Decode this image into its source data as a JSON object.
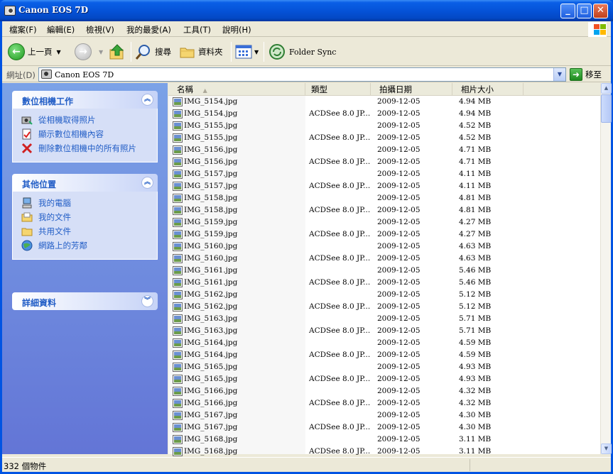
{
  "window": {
    "title": "Canon EOS 7D"
  },
  "menu": [
    "檔案(F)",
    "編輯(E)",
    "檢視(V)",
    "我的最愛(A)",
    "工具(T)",
    "說明(H)"
  ],
  "toolbar": {
    "back": "上一頁",
    "search": "搜尋",
    "folders": "資料夾",
    "folder_sync": "Folder Sync"
  },
  "address": {
    "label": "網址(D)",
    "value": "Canon EOS 7D",
    "go": "移至"
  },
  "taskpane": {
    "camera_tasks": {
      "title": "數位相機工作",
      "links": [
        "從相機取得照片",
        "顯示數位相機內容",
        "刪除數位相機中的所有照片"
      ]
    },
    "other_places": {
      "title": "其他位置",
      "links": [
        "我的電腦",
        "我的文件",
        "共用文件",
        "網路上的芳鄰"
      ]
    },
    "details": {
      "title": "詳細資料"
    }
  },
  "columns": {
    "name": "名稱",
    "type": "類型",
    "date": "拍攝日期",
    "size": "相片大小"
  },
  "files": [
    {
      "name": "IMG_5154.jpg",
      "type": "",
      "date": "2009-12-05",
      "size": "4.94 MB"
    },
    {
      "name": "IMG_5154.jpg",
      "type": "ACDSee 8.0 JP...",
      "date": "2009-12-05",
      "size": "4.94 MB"
    },
    {
      "name": "IMG_5155.jpg",
      "type": "",
      "date": "2009-12-05",
      "size": "4.52 MB"
    },
    {
      "name": "IMG_5155.jpg",
      "type": "ACDSee 8.0 JP...",
      "date": "2009-12-05",
      "size": "4.52 MB"
    },
    {
      "name": "IMG_5156.jpg",
      "type": "",
      "date": "2009-12-05",
      "size": "4.71 MB"
    },
    {
      "name": "IMG_5156.jpg",
      "type": "ACDSee 8.0 JP...",
      "date": "2009-12-05",
      "size": "4.71 MB"
    },
    {
      "name": "IMG_5157.jpg",
      "type": "",
      "date": "2009-12-05",
      "size": "4.11 MB"
    },
    {
      "name": "IMG_5157.jpg",
      "type": "ACDSee 8.0 JP...",
      "date": "2009-12-05",
      "size": "4.11 MB"
    },
    {
      "name": "IMG_5158.jpg",
      "type": "",
      "date": "2009-12-05",
      "size": "4.81 MB"
    },
    {
      "name": "IMG_5158.jpg",
      "type": "ACDSee 8.0 JP...",
      "date": "2009-12-05",
      "size": "4.81 MB"
    },
    {
      "name": "IMG_5159.jpg",
      "type": "",
      "date": "2009-12-05",
      "size": "4.27 MB"
    },
    {
      "name": "IMG_5159.jpg",
      "type": "ACDSee 8.0 JP...",
      "date": "2009-12-05",
      "size": "4.27 MB"
    },
    {
      "name": "IMG_5160.jpg",
      "type": "",
      "date": "2009-12-05",
      "size": "4.63 MB"
    },
    {
      "name": "IMG_5160.jpg",
      "type": "ACDSee 8.0 JP...",
      "date": "2009-12-05",
      "size": "4.63 MB"
    },
    {
      "name": "IMG_5161.jpg",
      "type": "",
      "date": "2009-12-05",
      "size": "5.46 MB"
    },
    {
      "name": "IMG_5161.jpg",
      "type": "ACDSee 8.0 JP...",
      "date": "2009-12-05",
      "size": "5.46 MB"
    },
    {
      "name": "IMG_5162.jpg",
      "type": "",
      "date": "2009-12-05",
      "size": "5.12 MB"
    },
    {
      "name": "IMG_5162.jpg",
      "type": "ACDSee 8.0 JP...",
      "date": "2009-12-05",
      "size": "5.12 MB"
    },
    {
      "name": "IMG_5163.jpg",
      "type": "",
      "date": "2009-12-05",
      "size": "5.71 MB"
    },
    {
      "name": "IMG_5163.jpg",
      "type": "ACDSee 8.0 JP...",
      "date": "2009-12-05",
      "size": "5.71 MB"
    },
    {
      "name": "IMG_5164.jpg",
      "type": "",
      "date": "2009-12-05",
      "size": "4.59 MB"
    },
    {
      "name": "IMG_5164.jpg",
      "type": "ACDSee 8.0 JP...",
      "date": "2009-12-05",
      "size": "4.59 MB"
    },
    {
      "name": "IMG_5165.jpg",
      "type": "",
      "date": "2009-12-05",
      "size": "4.93 MB"
    },
    {
      "name": "IMG_5165.jpg",
      "type": "ACDSee 8.0 JP...",
      "date": "2009-12-05",
      "size": "4.93 MB"
    },
    {
      "name": "IMG_5166.jpg",
      "type": "",
      "date": "2009-12-05",
      "size": "4.32 MB"
    },
    {
      "name": "IMG_5166.jpg",
      "type": "ACDSee 8.0 JP...",
      "date": "2009-12-05",
      "size": "4.32 MB"
    },
    {
      "name": "IMG_5167.jpg",
      "type": "",
      "date": "2009-12-05",
      "size": "4.30 MB"
    },
    {
      "name": "IMG_5167.jpg",
      "type": "ACDSee 8.0 JP...",
      "date": "2009-12-05",
      "size": "4.30 MB"
    },
    {
      "name": "IMG_5168.jpg",
      "type": "",
      "date": "2009-12-05",
      "size": "3.11 MB"
    },
    {
      "name": "IMG_5168.jpg",
      "type": "ACDSee 8.0 JP...",
      "date": "2009-12-05",
      "size": "3.11 MB"
    }
  ],
  "status": {
    "text": "332 個物件"
  }
}
